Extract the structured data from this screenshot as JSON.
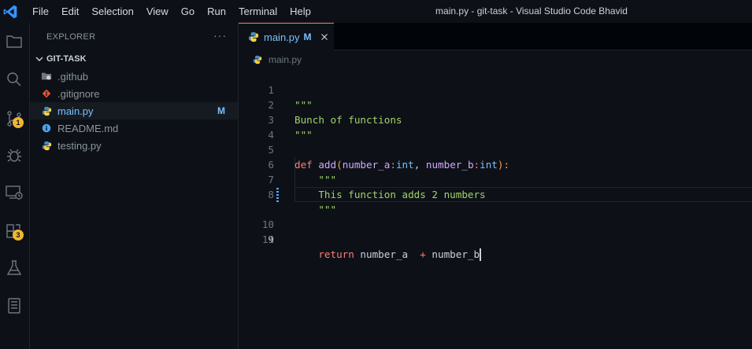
{
  "menu": [
    "File",
    "Edit",
    "Selection",
    "View",
    "Go",
    "Run",
    "Terminal",
    "Help"
  ],
  "window_title": "main.py - git-task - Visual Studio Code Bhavid",
  "activity_bar": {
    "source_control_badge": "1",
    "extensions_badge": "3"
  },
  "sidebar": {
    "header": "EXPLORER",
    "more": "···",
    "folder": "GIT-TASK",
    "files": [
      {
        "name": ".github",
        "status": ""
      },
      {
        "name": ".gitignore",
        "status": ""
      },
      {
        "name": "main.py",
        "status": "M"
      },
      {
        "name": "README.md",
        "status": ""
      },
      {
        "name": "testing.py",
        "status": ""
      }
    ]
  },
  "editor": {
    "tab": {
      "label": "main.py",
      "status": "M"
    },
    "breadcrumb": "main.py",
    "line_numbers": [
      "1",
      "2",
      "3",
      "4",
      "5",
      "6",
      "7",
      "8",
      "9",
      "10",
      "11"
    ],
    "code": {
      "l1": "\"\"\"",
      "l2": "Bunch of functions",
      "l3": "\"\"\"",
      "l5_def": "def",
      "l5_name": "add",
      "l5_open": "(",
      "l5_p1": "number_a",
      "l5_c1": ":",
      "l5_t1": "int",
      "l5_comma": ", ",
      "l5_p2": "number_b",
      "l5_c2": ":",
      "l5_t2": "int",
      "l5_close": "):",
      "l6": "\"\"\"",
      "l7": "This function adds 2 numbers",
      "l8": "\"\"\"",
      "l9_ret": "return",
      "l9_a": " number_a  ",
      "l9_op": "+",
      "l9_b": " number_b"
    }
  },
  "colors": {
    "accent": "#79c0ff",
    "badge": "#f0b72f",
    "keyword": "#ff7b72",
    "function": "#d2a8ff",
    "string": "#a2d26b"
  }
}
